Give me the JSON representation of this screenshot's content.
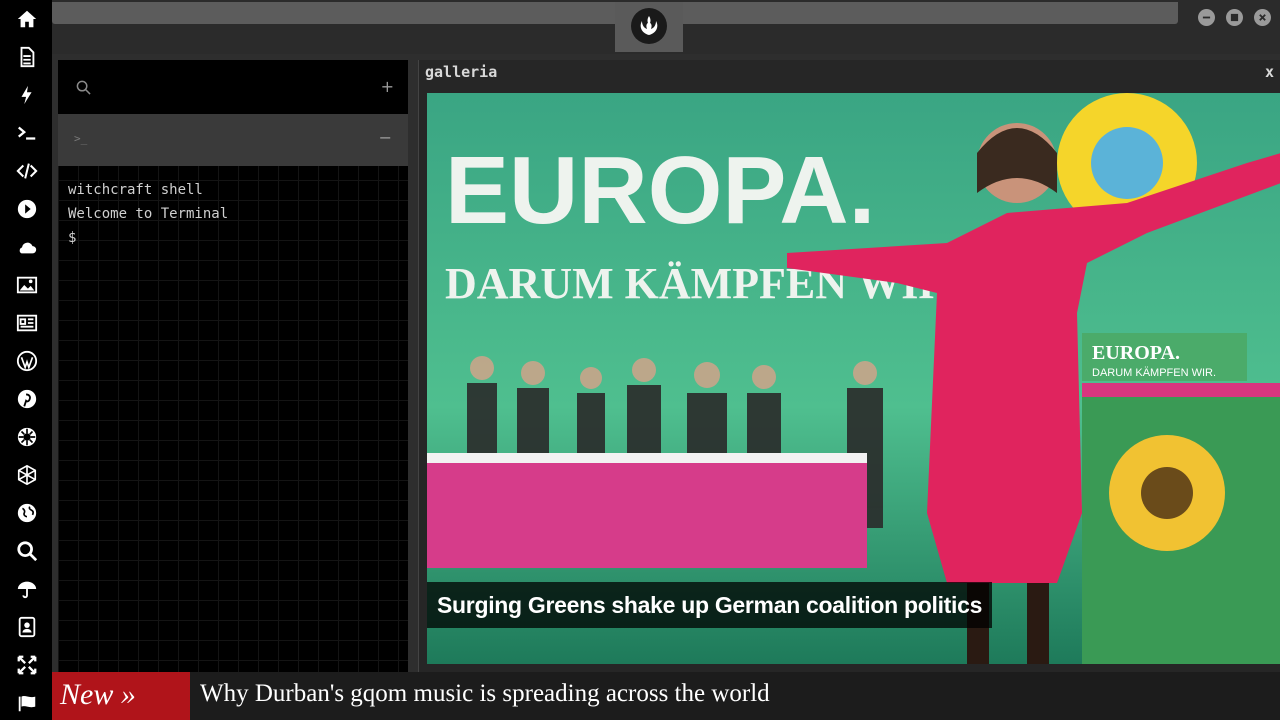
{
  "topbar": {
    "input_value": "",
    "logo_icon": "rebel-alliance-icon"
  },
  "window_controls": [
    "minimize-icon",
    "maximize-icon",
    "close-icon"
  ],
  "sidebar": {
    "items": [
      {
        "icon": "home-icon"
      },
      {
        "icon": "document-icon"
      },
      {
        "icon": "lightning-icon"
      },
      {
        "icon": "terminal-icon"
      },
      {
        "icon": "code-icon"
      },
      {
        "icon": "play-icon"
      },
      {
        "icon": "cloud-icon"
      },
      {
        "icon": "image-icon"
      },
      {
        "icon": "newspaper-icon"
      },
      {
        "icon": "wordpress-icon"
      },
      {
        "icon": "pinterest-icon"
      },
      {
        "icon": "galactic-empire-icon"
      },
      {
        "icon": "network-icon"
      },
      {
        "icon": "globe-icon"
      },
      {
        "icon": "search-icon"
      },
      {
        "icon": "umbrella-icon"
      },
      {
        "icon": "contacts-icon"
      },
      {
        "icon": "expand-icon"
      },
      {
        "icon": "flag-icon"
      }
    ]
  },
  "left_panel": {
    "search_placeholder": "",
    "add_label": "+",
    "terminal_tab_icon": ">_",
    "minimize_label": "−",
    "terminal_lines": [
      "witchcraft shell",
      "Welcome to Terminal",
      "$"
    ]
  },
  "gallery": {
    "title": "galleria",
    "close_label": "x",
    "caption": "Surging Greens shake up German coalition politics",
    "photo_texts": {
      "banner_line1": "EUROPA.",
      "banner_line2": "DARUM KÄMPFEN WIR.",
      "podium_line1": "EUROPA.",
      "podium_line2": "DARUM KÄMPFEN WIR."
    }
  },
  "ticker": {
    "label": "New »",
    "headline": "Why Durban's gqom music is spreading across the world"
  },
  "colors": {
    "ticker_label_bg": "#b0141a",
    "photo_green": "#2a8a6a",
    "dress_pink": "#e0245e"
  }
}
